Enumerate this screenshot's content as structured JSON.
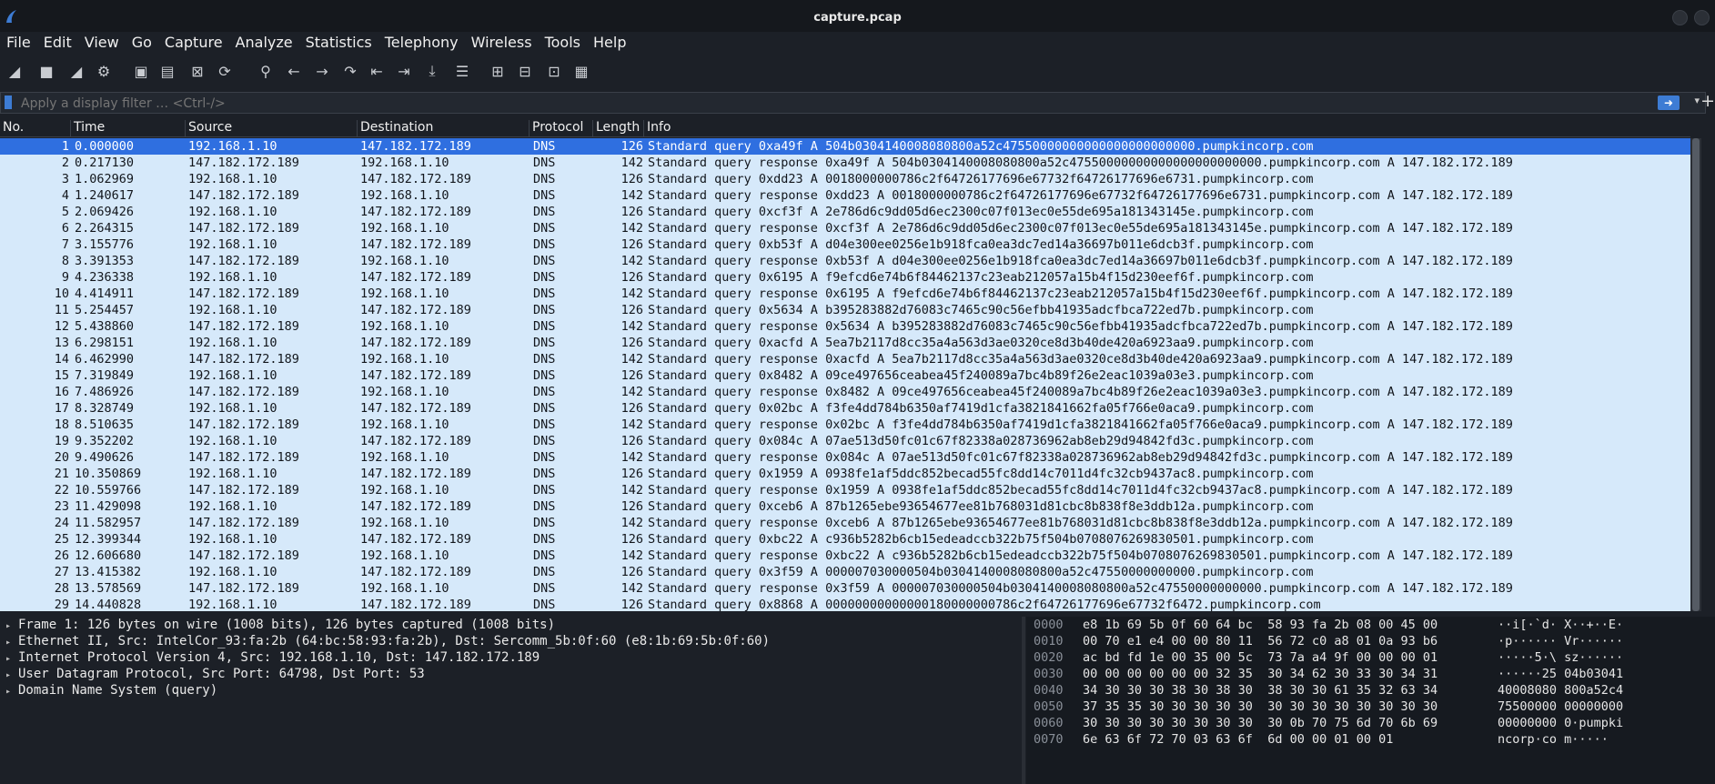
{
  "window": {
    "title": "capture.pcap"
  },
  "menu": [
    "File",
    "Edit",
    "View",
    "Go",
    "Capture",
    "Analyze",
    "Statistics",
    "Telephony",
    "Wireless",
    "Tools",
    "Help"
  ],
  "toolbar": [
    {
      "name": "start-capture-icon",
      "glyph": "◢"
    },
    {
      "name": "stop-capture-icon",
      "glyph": "■"
    },
    {
      "name": "restart-capture-icon",
      "glyph": "◢"
    },
    {
      "name": "capture-options-icon",
      "glyph": "⚙"
    },
    {
      "name": "open-file-icon",
      "glyph": "▣"
    },
    {
      "name": "save-file-icon",
      "glyph": "▤"
    },
    {
      "name": "close-file-icon",
      "glyph": "⊠"
    },
    {
      "name": "reload-file-icon",
      "glyph": "⟳"
    },
    {
      "name": "find-packet-icon",
      "glyph": "⚲"
    },
    {
      "name": "go-back-icon",
      "glyph": "←"
    },
    {
      "name": "go-forward-icon",
      "glyph": "→"
    },
    {
      "name": "go-to-packet-icon",
      "glyph": "↷"
    },
    {
      "name": "first-packet-icon",
      "glyph": "⇤"
    },
    {
      "name": "last-packet-icon",
      "glyph": "⇥"
    },
    {
      "name": "auto-scroll-icon",
      "glyph": "⤓"
    },
    {
      "name": "colorize-icon",
      "glyph": "☰"
    },
    {
      "name": "zoom-in-icon",
      "glyph": "⊞"
    },
    {
      "name": "zoom-out-icon",
      "glyph": "⊟"
    },
    {
      "name": "normal-size-icon",
      "glyph": "⊡"
    },
    {
      "name": "resize-columns-icon",
      "glyph": "▦"
    }
  ],
  "filter": {
    "placeholder": "Apply a display filter … <Ctrl-/>"
  },
  "columns": {
    "no": "No.",
    "time": "Time",
    "source": "Source",
    "destination": "Destination",
    "protocol": "Protocol",
    "length": "Length",
    "info": "Info"
  },
  "packets": [
    [
      "1",
      "0.000000",
      "192.168.1.10",
      "147.182.172.189",
      "DNS",
      "126",
      "Standard query 0xa49f A 504b0304140008080800a52c47550000000000000000000000.pumpkincorp.com"
    ],
    [
      "2",
      "0.217130",
      "147.182.172.189",
      "192.168.1.10",
      "DNS",
      "142",
      "Standard query response 0xa49f A 504b0304140008080800a52c47550000000000000000000000.pumpkincorp.com A 147.182.172.189"
    ],
    [
      "3",
      "1.062969",
      "192.168.1.10",
      "147.182.172.189",
      "DNS",
      "126",
      "Standard query 0xdd23 A 0018000000786c2f64726177696e67732f64726177696e6731.pumpkincorp.com"
    ],
    [
      "4",
      "1.240617",
      "147.182.172.189",
      "192.168.1.10",
      "DNS",
      "142",
      "Standard query response 0xdd23 A 0018000000786c2f64726177696e67732f64726177696e6731.pumpkincorp.com A 147.182.172.189"
    ],
    [
      "5",
      "2.069426",
      "192.168.1.10",
      "147.182.172.189",
      "DNS",
      "126",
      "Standard query 0xcf3f A 2e786d6c9dd05d6ec2300c07f013ec0e55de695a181343145e.pumpkincorp.com"
    ],
    [
      "6",
      "2.264315",
      "147.182.172.189",
      "192.168.1.10",
      "DNS",
      "142",
      "Standard query response 0xcf3f A 2e786d6c9dd05d6ec2300c07f013ec0e55de695a181343145e.pumpkincorp.com A 147.182.172.189"
    ],
    [
      "7",
      "3.155776",
      "192.168.1.10",
      "147.182.172.189",
      "DNS",
      "126",
      "Standard query 0xb53f A d04e300ee0256e1b918fca0ea3dc7ed14a36697b011e6dcb3f.pumpkincorp.com"
    ],
    [
      "8",
      "3.391353",
      "147.182.172.189",
      "192.168.1.10",
      "DNS",
      "142",
      "Standard query response 0xb53f A d04e300ee0256e1b918fca0ea3dc7ed14a36697b011e6dcb3f.pumpkincorp.com A 147.182.172.189"
    ],
    [
      "9",
      "4.236338",
      "192.168.1.10",
      "147.182.172.189",
      "DNS",
      "126",
      "Standard query 0x6195 A f9efcd6e74b6f84462137c23eab212057a15b4f15d230eef6f.pumpkincorp.com"
    ],
    [
      "10",
      "4.414911",
      "147.182.172.189",
      "192.168.1.10",
      "DNS",
      "142",
      "Standard query response 0x6195 A f9efcd6e74b6f84462137c23eab212057a15b4f15d230eef6f.pumpkincorp.com A 147.182.172.189"
    ],
    [
      "11",
      "5.254457",
      "192.168.1.10",
      "147.182.172.189",
      "DNS",
      "126",
      "Standard query 0x5634 A b395283882d76083c7465c90c56efbb41935adcfbca722ed7b.pumpkincorp.com"
    ],
    [
      "12",
      "5.438860",
      "147.182.172.189",
      "192.168.1.10",
      "DNS",
      "142",
      "Standard query response 0x5634 A b395283882d76083c7465c90c56efbb41935adcfbca722ed7b.pumpkincorp.com A 147.182.172.189"
    ],
    [
      "13",
      "6.298151",
      "192.168.1.10",
      "147.182.172.189",
      "DNS",
      "126",
      "Standard query 0xacfd A 5ea7b2117d8cc35a4a563d3ae0320ce8d3b40de420a6923aa9.pumpkincorp.com"
    ],
    [
      "14",
      "6.462990",
      "147.182.172.189",
      "192.168.1.10",
      "DNS",
      "142",
      "Standard query response 0xacfd A 5ea7b2117d8cc35a4a563d3ae0320ce8d3b40de420a6923aa9.pumpkincorp.com A 147.182.172.189"
    ],
    [
      "15",
      "7.319849",
      "192.168.1.10",
      "147.182.172.189",
      "DNS",
      "126",
      "Standard query 0x8482 A 09ce497656ceabea45f240089a7bc4b89f26e2eac1039a03e3.pumpkincorp.com"
    ],
    [
      "16",
      "7.486926",
      "147.182.172.189",
      "192.168.1.10",
      "DNS",
      "142",
      "Standard query response 0x8482 A 09ce497656ceabea45f240089a7bc4b89f26e2eac1039a03e3.pumpkincorp.com A 147.182.172.189"
    ],
    [
      "17",
      "8.328749",
      "192.168.1.10",
      "147.182.172.189",
      "DNS",
      "126",
      "Standard query 0x02bc A f3fe4dd784b6350af7419d1cfa3821841662fa05f766e0aca9.pumpkincorp.com"
    ],
    [
      "18",
      "8.510635",
      "147.182.172.189",
      "192.168.1.10",
      "DNS",
      "142",
      "Standard query response 0x02bc A f3fe4dd784b6350af7419d1cfa3821841662fa05f766e0aca9.pumpkincorp.com A 147.182.172.189"
    ],
    [
      "19",
      "9.352202",
      "192.168.1.10",
      "147.182.172.189",
      "DNS",
      "126",
      "Standard query 0x084c A 07ae513d50fc01c67f82338a028736962ab8eb29d94842fd3c.pumpkincorp.com"
    ],
    [
      "20",
      "9.490626",
      "147.182.172.189",
      "192.168.1.10",
      "DNS",
      "142",
      "Standard query response 0x084c A 07ae513d50fc01c67f82338a028736962ab8eb29d94842fd3c.pumpkincorp.com A 147.182.172.189"
    ],
    [
      "21",
      "10.350869",
      "192.168.1.10",
      "147.182.172.189",
      "DNS",
      "126",
      "Standard query 0x1959 A 0938fe1af5ddc852becad55fc8dd14c7011d4fc32cb9437ac8.pumpkincorp.com"
    ],
    [
      "22",
      "10.559766",
      "147.182.172.189",
      "192.168.1.10",
      "DNS",
      "142",
      "Standard query response 0x1959 A 0938fe1af5ddc852becad55fc8dd14c7011d4fc32cb9437ac8.pumpkincorp.com A 147.182.172.189"
    ],
    [
      "23",
      "11.429098",
      "192.168.1.10",
      "147.182.172.189",
      "DNS",
      "126",
      "Standard query 0xceb6 A 87b1265ebe93654677ee81b768031d81cbc8b838f8e3ddb12a.pumpkincorp.com"
    ],
    [
      "24",
      "11.582957",
      "147.182.172.189",
      "192.168.1.10",
      "DNS",
      "142",
      "Standard query response 0xceb6 A 87b1265ebe93654677ee81b768031d81cbc8b838f8e3ddb12a.pumpkincorp.com A 147.182.172.189"
    ],
    [
      "25",
      "12.399344",
      "192.168.1.10",
      "147.182.172.189",
      "DNS",
      "126",
      "Standard query 0xbc22 A c936b5282b6cb15edeadccb322b75f504b0708076269830501.pumpkincorp.com"
    ],
    [
      "26",
      "12.606680",
      "147.182.172.189",
      "192.168.1.10",
      "DNS",
      "142",
      "Standard query response 0xbc22 A c936b5282b6cb15edeadccb322b75f504b0708076269830501.pumpkincorp.com A 147.182.172.189"
    ],
    [
      "27",
      "13.415382",
      "192.168.1.10",
      "147.182.172.189",
      "DNS",
      "126",
      "Standard query 0x3f59 A 000007030000504b0304140008080800a52c47550000000000.pumpkincorp.com"
    ],
    [
      "28",
      "13.578569",
      "147.182.172.189",
      "192.168.1.10",
      "DNS",
      "142",
      "Standard query response 0x3f59 A 000007030000504b0304140008080800a52c47550000000000.pumpkincorp.com A 147.182.172.189"
    ],
    [
      "29",
      "14.440828",
      "192.168.1.10",
      "147.182.172.189",
      "DNS",
      "126",
      "Standard query 0x8868 A 00000000000000180000000786c2f64726177696e67732f6472.pumpkincorp.com"
    ]
  ],
  "details": [
    "Frame 1: 126 bytes on wire (1008 bits), 126 bytes captured (1008 bits)",
    "Ethernet II, Src: IntelCor_93:fa:2b (64:bc:58:93:fa:2b), Dst: Sercomm_5b:0f:60 (e8:1b:69:5b:0f:60)",
    "Internet Protocol Version 4, Src: 192.168.1.10, Dst: 147.182.172.189",
    "User Datagram Protocol, Src Port: 64798, Dst Port: 53",
    "Domain Name System (query)"
  ],
  "bytes": [
    [
      "0000",
      "e8 1b 69 5b 0f 60 64 bc  58 93 fa 2b 08 00 45 00",
      "··i[·`d· X··+··E·"
    ],
    [
      "0010",
      "00 70 e1 e4 00 00 80 11  56 72 c0 a8 01 0a 93 b6",
      "·p······ Vr······"
    ],
    [
      "0020",
      "ac bd fd 1e 00 35 00 5c  73 7a a4 9f 00 00 00 01",
      "·····5·\\ sz······"
    ],
    [
      "0030",
      "00 00 00 00 00 00 32 35  30 34 62 30 33 30 34 31",
      "······25 04b03041"
    ],
    [
      "0040",
      "34 30 30 30 38 30 38 30  38 30 30 61 35 32 63 34",
      "40008080 800a52c4"
    ],
    [
      "0050",
      "37 35 35 30 30 30 30 30  30 30 30 30 30 30 30 30",
      "75500000 00000000"
    ],
    [
      "0060",
      "30 30 30 30 30 30 30 30  30 0b 70 75 6d 70 6b 69",
      "00000000 0·pumpki"
    ],
    [
      "0070",
      "6e 63 6f 72 70 03 63 6f  6d 00 00 01 00 01",
      "ncorp·co m·····"
    ]
  ]
}
